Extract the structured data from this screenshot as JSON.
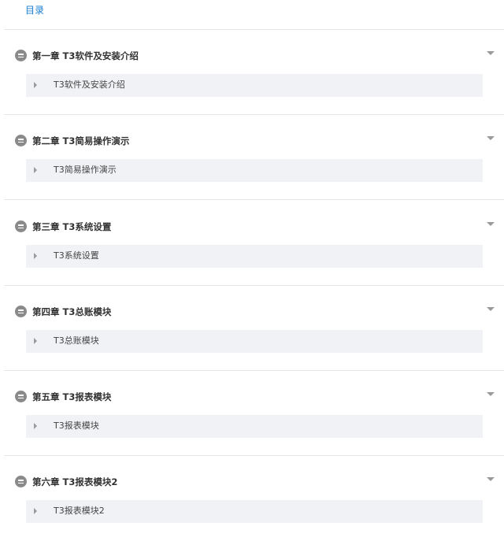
{
  "toc": {
    "tab_label": "目录"
  },
  "chapters": [
    {
      "title": "第一章 T3软件及安装介绍",
      "sections": [
        "T3软件及安装介绍"
      ]
    },
    {
      "title": "第二章 T3简易操作演示",
      "sections": [
        "T3简易操作演示"
      ]
    },
    {
      "title": "第三章 T3系统设置",
      "sections": [
        "T3系统设置"
      ]
    },
    {
      "title": "第四章 T3总账模块",
      "sections": [
        "T3总账模块"
      ]
    },
    {
      "title": "第五章 T3报表模块",
      "sections": [
        "T3报表模块"
      ]
    },
    {
      "title": "第六章 T3报表模块2",
      "sections": [
        "T3报表模块2"
      ]
    }
  ],
  "icons": {
    "collapse": "collapse-circle-icon",
    "chevron": "chevron-down-icon",
    "caret": "caret-right-icon"
  },
  "colors": {
    "accent": "#1a7fd4",
    "section_bg": "#f0f2f5",
    "divider": "#e6e6e6"
  }
}
